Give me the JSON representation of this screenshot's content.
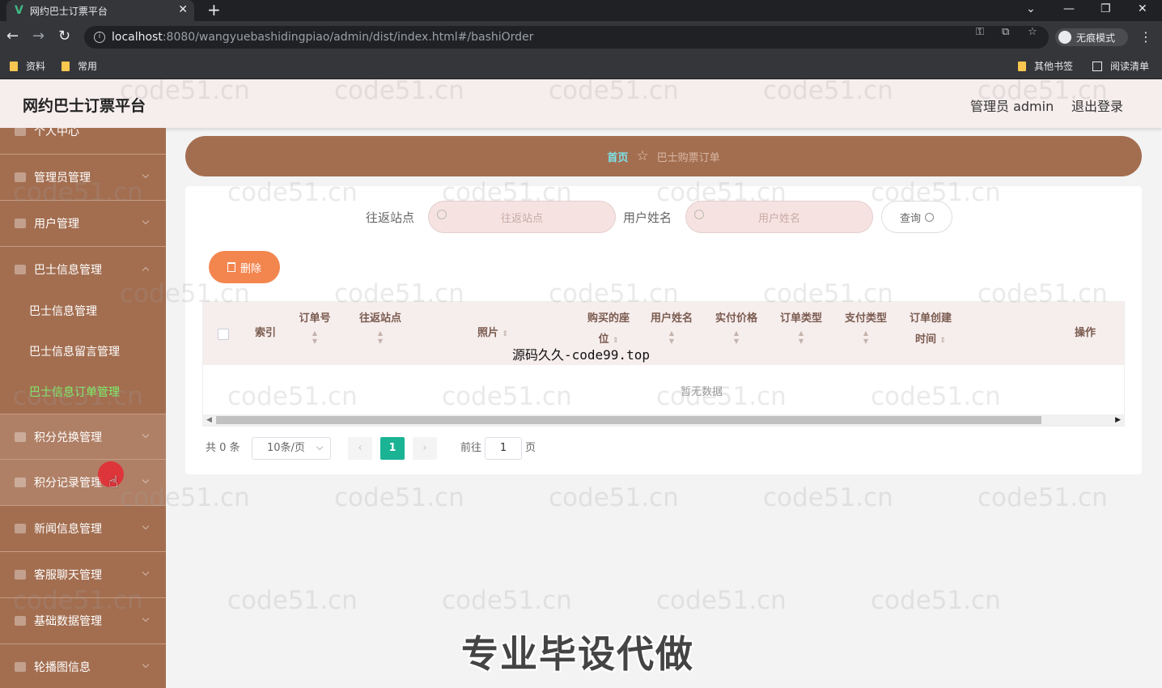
{
  "browser": {
    "tab_title": "网约巴士订票平台",
    "tab_close": "✕",
    "new_tab": "+",
    "url_host": "localhost",
    "url_rest": ":8080/wangyuebashidingpiao/admin/dist/index.html#/bashiOrder",
    "incognito_label": "无痕模式",
    "bookmarks": [
      "资料",
      "常用"
    ],
    "other_bookmarks": "其他书签",
    "reading_list": "阅读清单"
  },
  "header": {
    "title": "网约巴士订票平台",
    "admin": "管理员 admin",
    "logout": "退出登录"
  },
  "sidebar": {
    "partial_top": "个人中心",
    "items": [
      {
        "label": "管理员管理"
      },
      {
        "label": "用户管理"
      },
      {
        "label": "巴士信息管理"
      },
      {
        "label": "积分兑换管理"
      },
      {
        "label": "积分记录管理"
      },
      {
        "label": "新闻信息管理"
      },
      {
        "label": "客服聊天管理"
      },
      {
        "label": "基础数据管理"
      },
      {
        "label": "轮播图信息"
      }
    ],
    "sub_items": [
      {
        "label": "巴士信息管理"
      },
      {
        "label": "巴士信息留言管理"
      },
      {
        "label": "巴士信息订单管理"
      }
    ]
  },
  "breadcrumb": {
    "home": "首页",
    "current": "巴士购票订单"
  },
  "filters": {
    "station_label": "往返站点",
    "station_placeholder": "往返站点",
    "username_label": "用户姓名",
    "username_placeholder": "用户姓名",
    "query_button": "查询"
  },
  "actions": {
    "delete_button": "删除"
  },
  "table": {
    "columns": [
      {
        "l1": "索引",
        "l2": ""
      },
      {
        "l1": "订单号",
        "l2": ""
      },
      {
        "l1": "往返站点",
        "l2": ""
      },
      {
        "l1": "照片",
        "l2": ""
      },
      {
        "l1": "购买的座",
        "l2": "位"
      },
      {
        "l1": "用户姓名",
        "l2": ""
      },
      {
        "l1": "实付价格",
        "l2": ""
      },
      {
        "l1": "订单类型",
        "l2": ""
      },
      {
        "l1": "支付类型",
        "l2": ""
      },
      {
        "l1": "订单创建",
        "l2": "时间"
      },
      {
        "l1": "操作",
        "l2": ""
      }
    ],
    "empty_text": "暂无数据"
  },
  "pagination": {
    "total": "共 0 条",
    "page_size": "10条/页",
    "prev": "‹",
    "current_page": "1",
    "next": "›",
    "goto_prefix": "前往",
    "goto_value": "1",
    "goto_suffix": "页"
  },
  "overlays": {
    "watermark": "code51.cn",
    "caption_mid": "源码久久-code99.top",
    "caption_bottom": "专业毕设代做"
  }
}
